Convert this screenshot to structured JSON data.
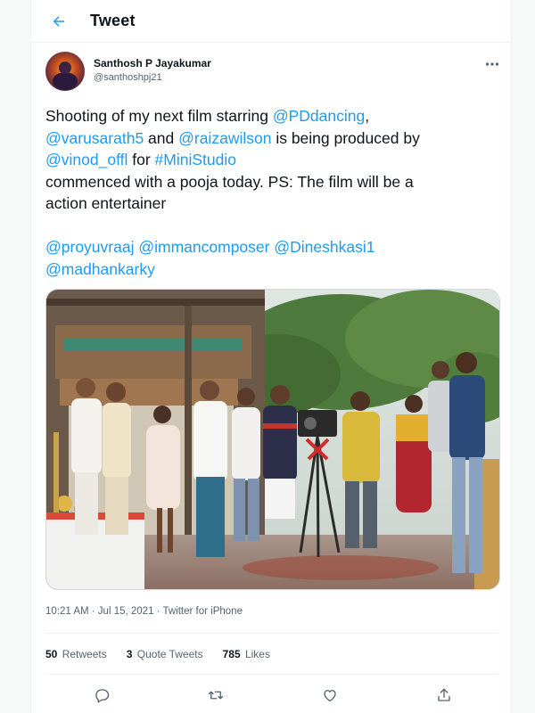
{
  "header": {
    "title": "Tweet",
    "back_icon": "arrow-left-icon",
    "accent": "#1d9bf0"
  },
  "author": {
    "name": "Santhosh P Jayakumar",
    "handle": "@santhoshpj21"
  },
  "tweet": {
    "line1_text": "Shooting of my next film starring ",
    "line1_mention": "@PDdancing",
    "line1_end": ",",
    "line2_mention_a": "@varusarath5",
    "line2_and": " and ",
    "line2_mention_b": "@raizawilson",
    "line2_end": " is being produced by",
    "line3_mention": "@vinod_offl",
    "line3_for": " for ",
    "line3_hashtag": "#MiniStudio",
    "line4": "commenced with a pooja today. PS: The film will be a",
    "line5": "action entertainer",
    "mentions_row1": [
      "@proyuvraaj",
      "@immancomposer",
      "@Dineshkasi1"
    ],
    "mentions_row2": [
      "@madhankarky"
    ]
  },
  "meta": {
    "time": "10:21 AM · Jul 15, 2021 · Twitter for iPhone"
  },
  "stats": {
    "retweets_count": "50",
    "retweets_label": "Retweets",
    "quotes_count": "3",
    "quotes_label": "Quote Tweets",
    "likes_count": "785",
    "likes_label": "Likes"
  },
  "actions": {
    "reply_icon": "reply-icon",
    "retweet_icon": "retweet-icon",
    "like_icon": "heart-icon",
    "share_icon": "share-icon"
  },
  "colors": {
    "text": "#0f1419",
    "secondary": "#536471",
    "link": "#1d9bf0",
    "border": "#eff3f4"
  }
}
